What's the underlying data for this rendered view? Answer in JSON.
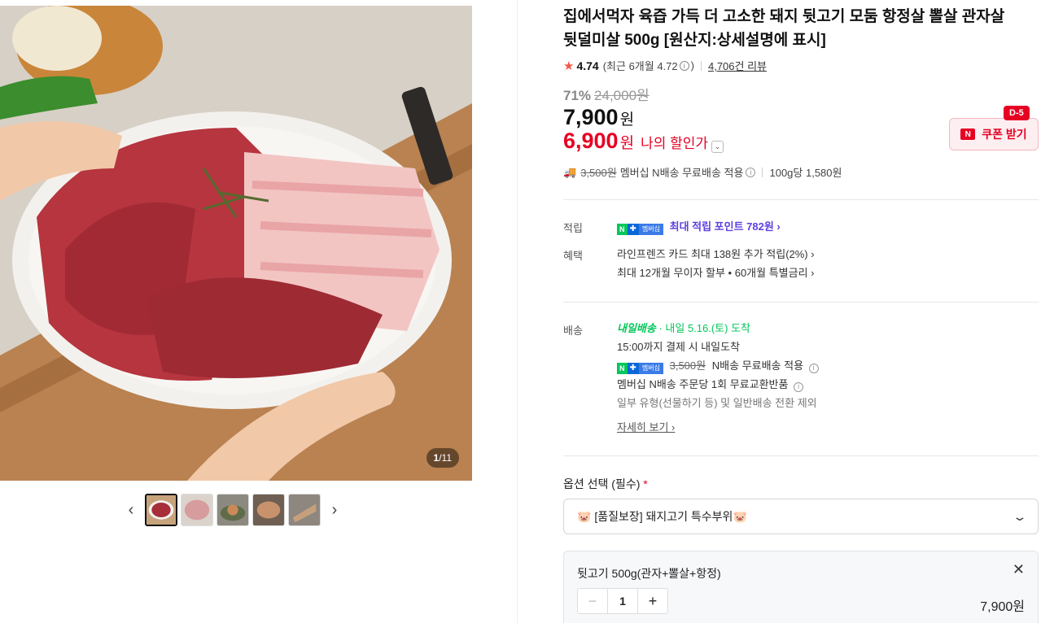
{
  "gallery": {
    "counter_current": "1",
    "counter_total": "/11",
    "prev_arrow": "‹",
    "next_arrow": "›"
  },
  "product": {
    "title": "집에서먹자 육즙 가득 더 고소한 돼지 뒷고기 모둠 항정살 뽈살 관자살 뒷덜미살 500g [원산지:상세설명에 표시]",
    "rating": "4.74",
    "recent_rating": "(최근 6개월 4.72",
    "recent_rating_close": ")",
    "reviews": "4,706건 리뷰",
    "discount_rate": "71%",
    "original_price": "24,000원",
    "price": "7,900",
    "won": "원",
    "my_price": "6,900",
    "my_won": "원",
    "my_label": "나의 할인가",
    "coupon_label": "쿠폰 받기",
    "coupon_dday": "D-5",
    "ship_strike": "3,500원",
    "ship_text": "멤버십 N배송 무료배송 적용",
    "unit_price": "100g당 1,580원"
  },
  "benefits": {
    "points_label": "적립",
    "points_text": "최대 적립 포인트 782원 ›",
    "benefit_label": "혜택",
    "benefit_1": "라인프렌즈 카드 최대 138원 추가 적립(2%) ›",
    "benefit_2": "최대 12개월 무이자 할부 • 60개월 특별금리 ›"
  },
  "delivery": {
    "label": "배송",
    "logo": "내일배송",
    "arrival": "· 내일 5.16.(토) 도착",
    "line1": "15:00까지 결제 시 내일도착",
    "line2_strike": "3,500원",
    "line2": "N배송 무료배송 적용",
    "line3": "멤버십 N배송 주문당 1회 무료교환반품",
    "line4": "일부 유형(선물하기 등) 및 일반배송 전환 제외",
    "more": "자세히 보기 ›",
    "badge_n": "N",
    "badge_plus": "✚",
    "badge_mem": "멤버십"
  },
  "options": {
    "label": "옵션 선택 (필수)",
    "required_mark": "*",
    "selected": "🐷 [품질보장] 돼지고기 특수부위🐷",
    "item_name": "뒷고기 500g(관자+뽈살+항정)",
    "quantity": "1",
    "item_price": "7,900원"
  },
  "icons": {
    "star": "star-icon",
    "truck": "truck-icon",
    "close": "close-icon",
    "chevron": "chevron-down-icon"
  },
  "colors": {
    "accent_red": "#e60022",
    "naver_green": "#03c75a",
    "points_purple": "#5e3fe0"
  }
}
